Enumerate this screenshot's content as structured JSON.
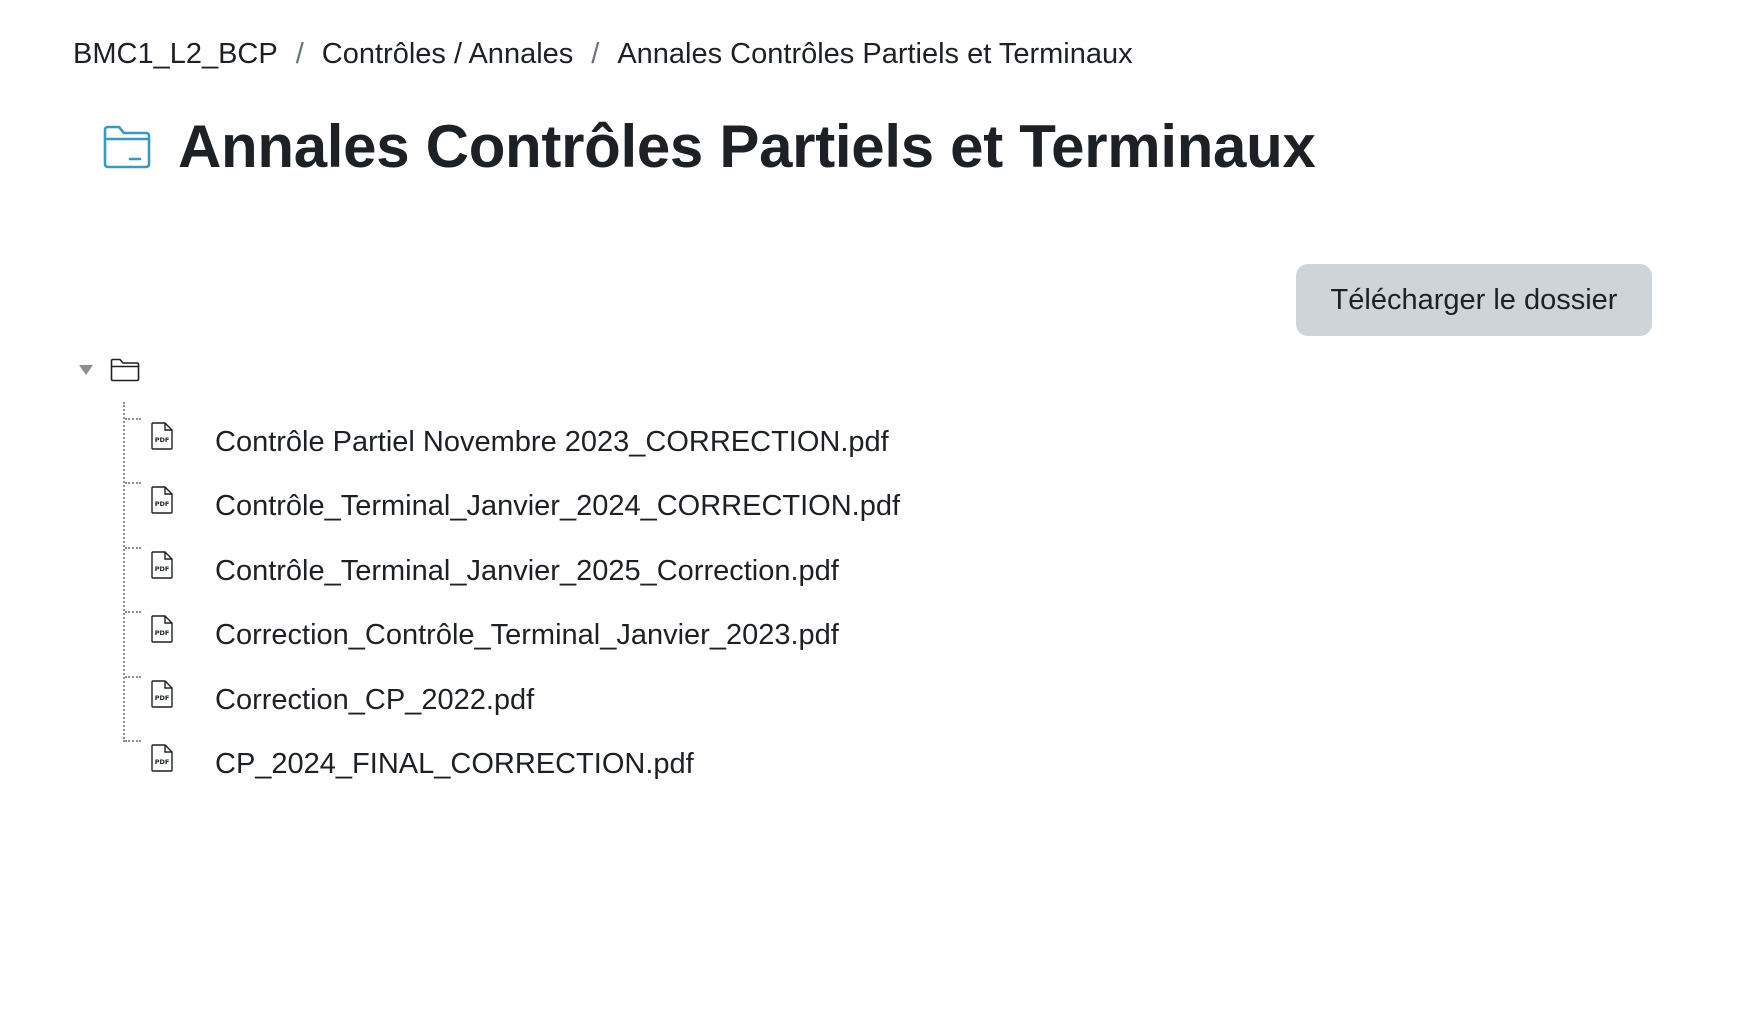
{
  "breadcrumb": {
    "items": [
      "BMC1_L2_BCP",
      "Contrôles / Annales",
      "Annales Contrôles Partiels et Terminaux"
    ],
    "separator": "/"
  },
  "header": {
    "icon": "folder-icon",
    "title": "Annales Contrôles Partiels et Terminaux"
  },
  "actions": {
    "download_label": "Télécharger le dossier"
  },
  "tree": {
    "expanded": true,
    "root_icon": "folder-icon",
    "files": [
      {
        "name": "Contrôle Partiel Novembre 2023_CORRECTION.pdf",
        "icon": "pdf-icon"
      },
      {
        "name": "Contrôle_Terminal_Janvier_2024_CORRECTION.pdf",
        "icon": "pdf-icon"
      },
      {
        "name": "Contrôle_Terminal_Janvier_2025_Correction.pdf",
        "icon": "pdf-icon"
      },
      {
        "name": "Correction_Contrôle_Terminal_Janvier_2023.pdf",
        "icon": "pdf-icon"
      },
      {
        "name": "Correction_CP_2022.pdf",
        "icon": "pdf-icon"
      },
      {
        "name": "CP_2024_FINAL_CORRECTION.pdf",
        "icon": "pdf-icon"
      }
    ]
  },
  "colors": {
    "accent_icon": "#399be2",
    "button_bg": "#ced4da",
    "text": "#1d2125"
  }
}
